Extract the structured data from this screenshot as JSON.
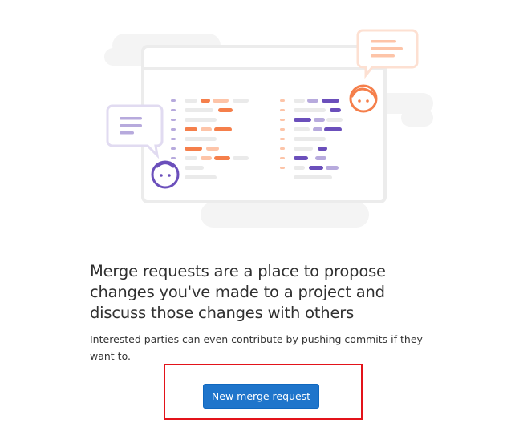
{
  "empty_state": {
    "title": "Merge requests are a place to propose changes you've made to a project and discuss those changes with others",
    "description": "Interested parties can even contribute by pushing commits if they want to.",
    "primary_button_label": "New merge request"
  },
  "illustration": {
    "icons": [
      "monitor-illustration",
      "chat-bubble-icon",
      "avatar-face-icon"
    ],
    "colors": {
      "orange": "#f57f4b",
      "orange_light": "#fdc4a8",
      "purple": "#6b4fbb",
      "purple_light": "#b7aadd",
      "gray": "#eaeaea",
      "outline": "#efefef"
    }
  },
  "colors": {
    "button_bg": "#1f75cb",
    "highlight_border": "#e3131a"
  }
}
